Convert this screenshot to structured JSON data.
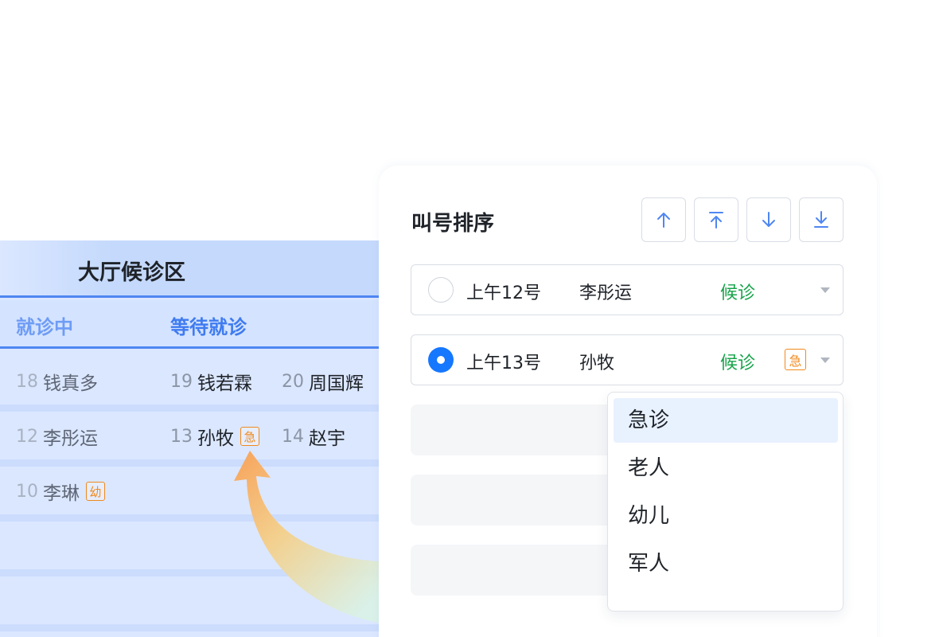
{
  "hall": {
    "title": "大厅候诊区",
    "tabs": {
      "current": "就诊中",
      "waiting": "等待就诊"
    },
    "rows": [
      [
        {
          "num": "18",
          "name": "钱真多",
          "tag": ""
        },
        {
          "num": "19",
          "name": "钱若霖",
          "tag": ""
        },
        {
          "num": "20",
          "name": "周国辉",
          "tag": ""
        }
      ],
      [
        {
          "num": "12",
          "name": "李彤运",
          "tag": ""
        },
        {
          "num": "13",
          "name": "孙牧",
          "tag": "急"
        },
        {
          "num": "14",
          "name": "赵宇",
          "tag": ""
        }
      ],
      [
        {
          "num": "10",
          "name": "李琳",
          "tag": "幼"
        }
      ]
    ]
  },
  "panel": {
    "title": "叫号排序",
    "sort_buttons": [
      "move-up",
      "move-to-top",
      "move-down",
      "move-to-bottom"
    ],
    "queue": [
      {
        "selected": false,
        "number": "上午12号",
        "name": "李彤运",
        "status": "候诊",
        "tag": ""
      },
      {
        "selected": true,
        "number": "上午13号",
        "name": "孙牧",
        "status": "候诊",
        "tag": "急"
      }
    ],
    "dropdown": {
      "options": [
        "急诊",
        "老人",
        "幼儿",
        "军人"
      ],
      "highlighted": "急诊"
    }
  },
  "colors": {
    "accent_blue": "#1677ff",
    "tab_blue": "#3f7bf0",
    "status_green": "#17a34a",
    "tag_orange": "#f08a1c"
  }
}
